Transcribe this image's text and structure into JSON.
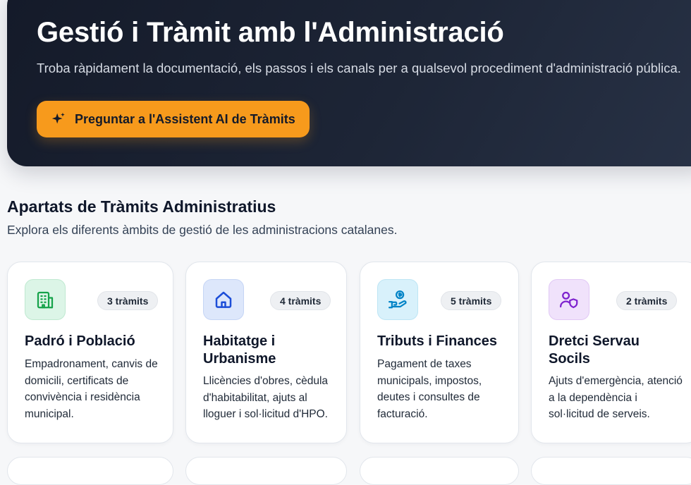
{
  "hero": {
    "title": "Gestió i Tràmit amb l'Administració",
    "subtitle": "Troba ràpidament la documentació, els passos i els canals per a qualsevol procediment d'administració pública.",
    "ai_button_label": "Preguntar a l'Assistent AI de Tràmits"
  },
  "section": {
    "title": "Apartats de Tràmits Administratius",
    "subtitle": "Explora els diferents àmbits de gestió de les administracions catalanes."
  },
  "cards": [
    {
      "icon": "building-icon",
      "badge": "3 tràmits",
      "title": "Padró i Població",
      "description": "Empadronament, canvis de domicili, certificats de convivència i residència municipal."
    },
    {
      "icon": "house-icon",
      "badge": "4 tràmits",
      "title": "Habitatge i Urbanisme",
      "description": "Llicències d'obres, cèdula d'habitabilitat, ajuts al lloguer i sol·licitud d'HPO."
    },
    {
      "icon": "hand-coin-icon",
      "badge": "5 tràmits",
      "title": "Tributs i Finances",
      "description": "Pagament de taxes municipals, impostos, deutes i consultes de facturació."
    },
    {
      "icon": "user-shield-icon",
      "badge": "2 tràmits",
      "title": "Dretci Servau Socils",
      "description": "Ajuts d'emergència, atenció a la dependència i sol·licitud de serveis."
    }
  ],
  "colors": {
    "hero_bg": "#1a2132",
    "accent": "#f79a1c",
    "green_tint": "#dcf5e7",
    "blue_tint": "#dde7fb",
    "cyan_tint": "#d8f1fb",
    "purple_tint": "#f0e2fb"
  }
}
